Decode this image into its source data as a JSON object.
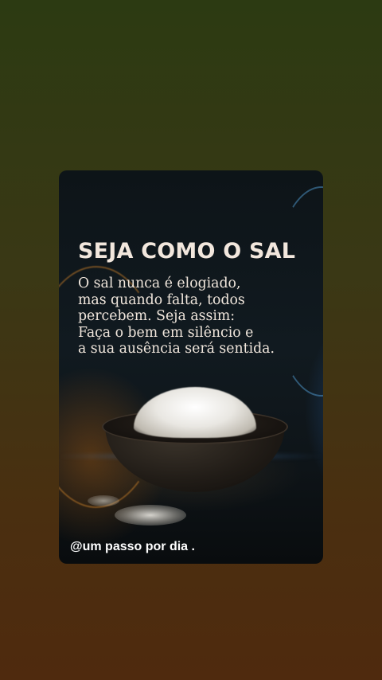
{
  "post": {
    "title": "SEJA COMO O SAL",
    "body_lines": [
      "O sal nunca é elogiado,",
      "mas quando falta, todos",
      "percebem. Seja assim:",
      "Faça o bem em silêncio e",
      "a sua ausência será sentida."
    ],
    "credit": "@um passo por dia ."
  },
  "image": {
    "subject": "bowl-of-salt-icon"
  },
  "colors": {
    "background_top": "#2c3a12",
    "background_bottom": "#4f2a0e",
    "card_background": "#0e1418",
    "text_primary": "#f0e6dc",
    "credit_text": "#ffffff"
  }
}
